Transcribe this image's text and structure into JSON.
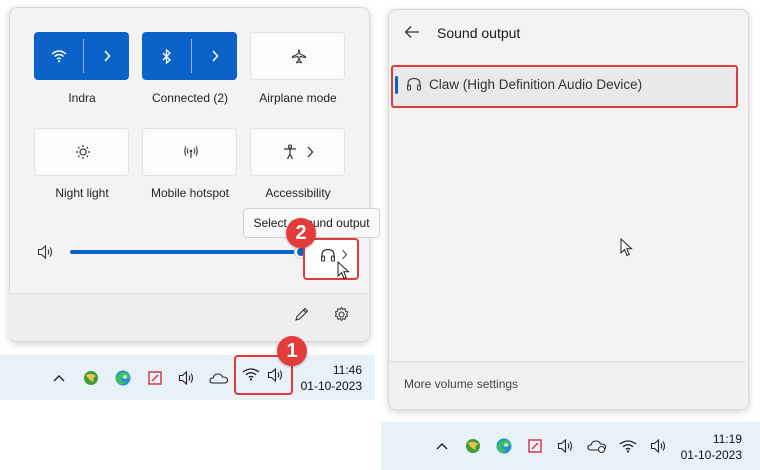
{
  "quick_settings": {
    "tiles": [
      {
        "label": "Indra",
        "icon": "wifi-icon",
        "on": true,
        "split": true
      },
      {
        "label": "Connected (2)",
        "icon": "bluetooth-icon",
        "on": true,
        "split": true
      },
      {
        "label": "Airplane mode",
        "icon": "airplane-icon",
        "on": false,
        "split": false
      },
      {
        "label": "Night light",
        "icon": "night-light-icon",
        "on": false,
        "split": false
      },
      {
        "label": "Mobile hotspot",
        "icon": "hotspot-icon",
        "on": false,
        "split": false
      },
      {
        "label": "Accessibility",
        "icon": "accessibility-icon",
        "on": false,
        "split": false
      }
    ],
    "tooltip": "Select a sound output",
    "volume_level": 1.0,
    "edit_icon": "pencil-icon",
    "settings_icon": "gear-icon"
  },
  "badges": {
    "step1": "1",
    "step2": "2"
  },
  "taskbar_left": {
    "time": "11:46",
    "date": "01-10-2023",
    "icons": [
      "chevron-up-icon",
      "app-globe-icon",
      "edge-icon",
      "snip-icon",
      "volume-icon",
      "onedrive-icon",
      "wifi-icon",
      "volume-icon"
    ]
  },
  "sound_output": {
    "title": "Sound output",
    "back_icon": "back-arrow-icon",
    "device": "Claw (High Definition Audio Device)",
    "footer": "More volume settings"
  },
  "taskbar_right": {
    "time": "11:19",
    "date": "01-10-2023",
    "icons": [
      "chevron-up-icon",
      "app-globe-icon",
      "edge-icon",
      "snip-icon",
      "volume-icon",
      "onedrive-sync-icon",
      "wifi-icon",
      "volume-icon"
    ]
  },
  "colors": {
    "accent": "#0b63c9",
    "highlight": "#e03a3a",
    "taskbar": "#e8f0f8"
  }
}
